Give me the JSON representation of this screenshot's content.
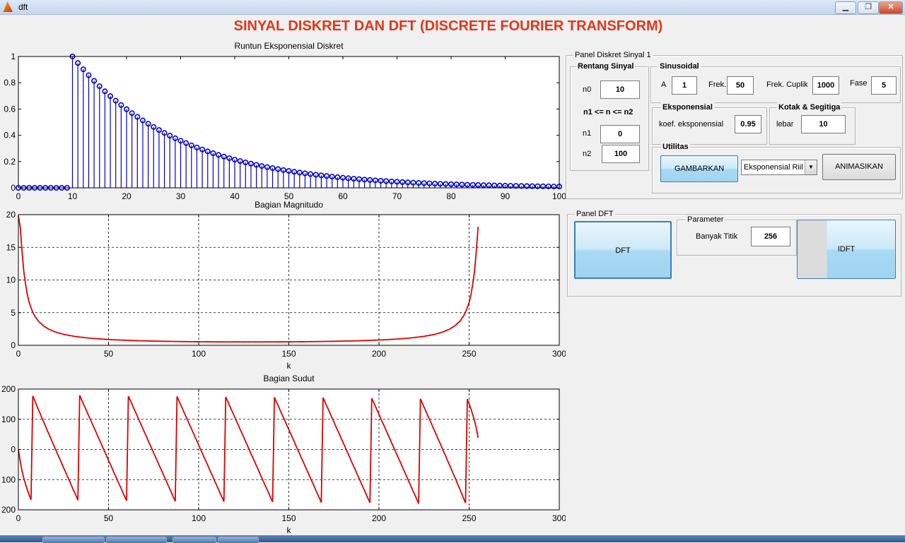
{
  "window": {
    "title": "dft",
    "buttons": {
      "minimize": "▁",
      "maximize": "❐",
      "close": "✕"
    }
  },
  "main_title": "SINYAL DISKRET DAN DFT (DISCRETE FOURIER TRANSFORM)",
  "chart_data": [
    {
      "type": "stem",
      "title": "Runtun Eksponensial Diskret",
      "xlabel": "",
      "ylabel": "",
      "xlim": [
        0,
        100
      ],
      "ylim": [
        0,
        1
      ],
      "xticks": [
        0,
        10,
        20,
        30,
        40,
        50,
        60,
        70,
        80,
        90,
        100
      ],
      "yticks": [
        0,
        0.2,
        0.4,
        0.6,
        0.8,
        1
      ],
      "ytick_labels": [
        "0",
        "0.2",
        "0.4",
        "0.6",
        "0.8",
        "1"
      ],
      "series": [
        {
          "color": "#0000cc",
          "n": [
            0,
            100
          ],
          "n0": 10,
          "base": 0.95
        }
      ]
    },
    {
      "type": "line",
      "title": "Bagian Magnitudo",
      "xlabel": "k",
      "ylabel": "",
      "xlim": [
        0,
        300
      ],
      "ylim": [
        0,
        20
      ],
      "xticks": [
        0,
        50,
        100,
        150,
        200,
        250,
        300
      ],
      "yticks": [
        0,
        5,
        10,
        15,
        20
      ],
      "grid": true,
      "series": [
        {
          "color": "#dd0000",
          "k": [
            0,
            255
          ],
          "N": 256,
          "base": 0.95,
          "n_range": [
            0,
            100
          ],
          "n0": 10
        }
      ]
    },
    {
      "type": "line",
      "title": "Bagian Sudut",
      "xlabel": "k",
      "ylabel": "",
      "xlim": [
        0,
        300
      ],
      "ylim": [
        -200,
        200
      ],
      "xticks": [
        0,
        50,
        100,
        150,
        200,
        250,
        300
      ],
      "yticks": [
        -200,
        -100,
        0,
        100,
        200
      ],
      "ytick_labels": [
        "200",
        "100",
        "0",
        "100",
        "200"
      ],
      "grid": true,
      "series": [
        {
          "color": "#dd0000",
          "k": [
            0,
            255
          ],
          "N": 256,
          "base": 0.95,
          "n_range": [
            0,
            100
          ],
          "n0": 10,
          "unit": "degrees"
        }
      ]
    }
  ],
  "panel_sinyal": {
    "title": "Panel Diskret Sinyal 1",
    "rentang": {
      "title": "Rentang Sinyal",
      "n0_label": "n0",
      "n0": "10",
      "range_label": "n1 <= n <= n2",
      "n1_label": "n1",
      "n1": "0",
      "n2_label": "n2",
      "n2": "100"
    },
    "sinusoidal": {
      "title": "Sinusoidal",
      "a_label": "A",
      "a": "1",
      "frek_label": "Frek.",
      "frek": "50",
      "cuplik_label": "Frek. Cuplik",
      "cuplik": "1000",
      "fase_label": "Fase",
      "fase": "5"
    },
    "eksponensial": {
      "title": "Eksponensial",
      "koef_label": "koef. eksponensial",
      "koef": "0.95"
    },
    "kotak": {
      "title": "Kotak & Segitiga",
      "lebar_label": "lebar",
      "lebar": "10"
    },
    "utilitas": {
      "title": "Utilitas",
      "gambarkan": "GAMBARKAN",
      "select_value": "Eksponensial Riil",
      "animasikan": "ANIMASIKAN"
    }
  },
  "panel_dft": {
    "title": "Panel DFT",
    "dft_button": "DFT",
    "parameter": {
      "title": "Parameter",
      "banyak_label": "Banyak Titik",
      "banyak": "256"
    },
    "idft_button": "IDFT"
  }
}
